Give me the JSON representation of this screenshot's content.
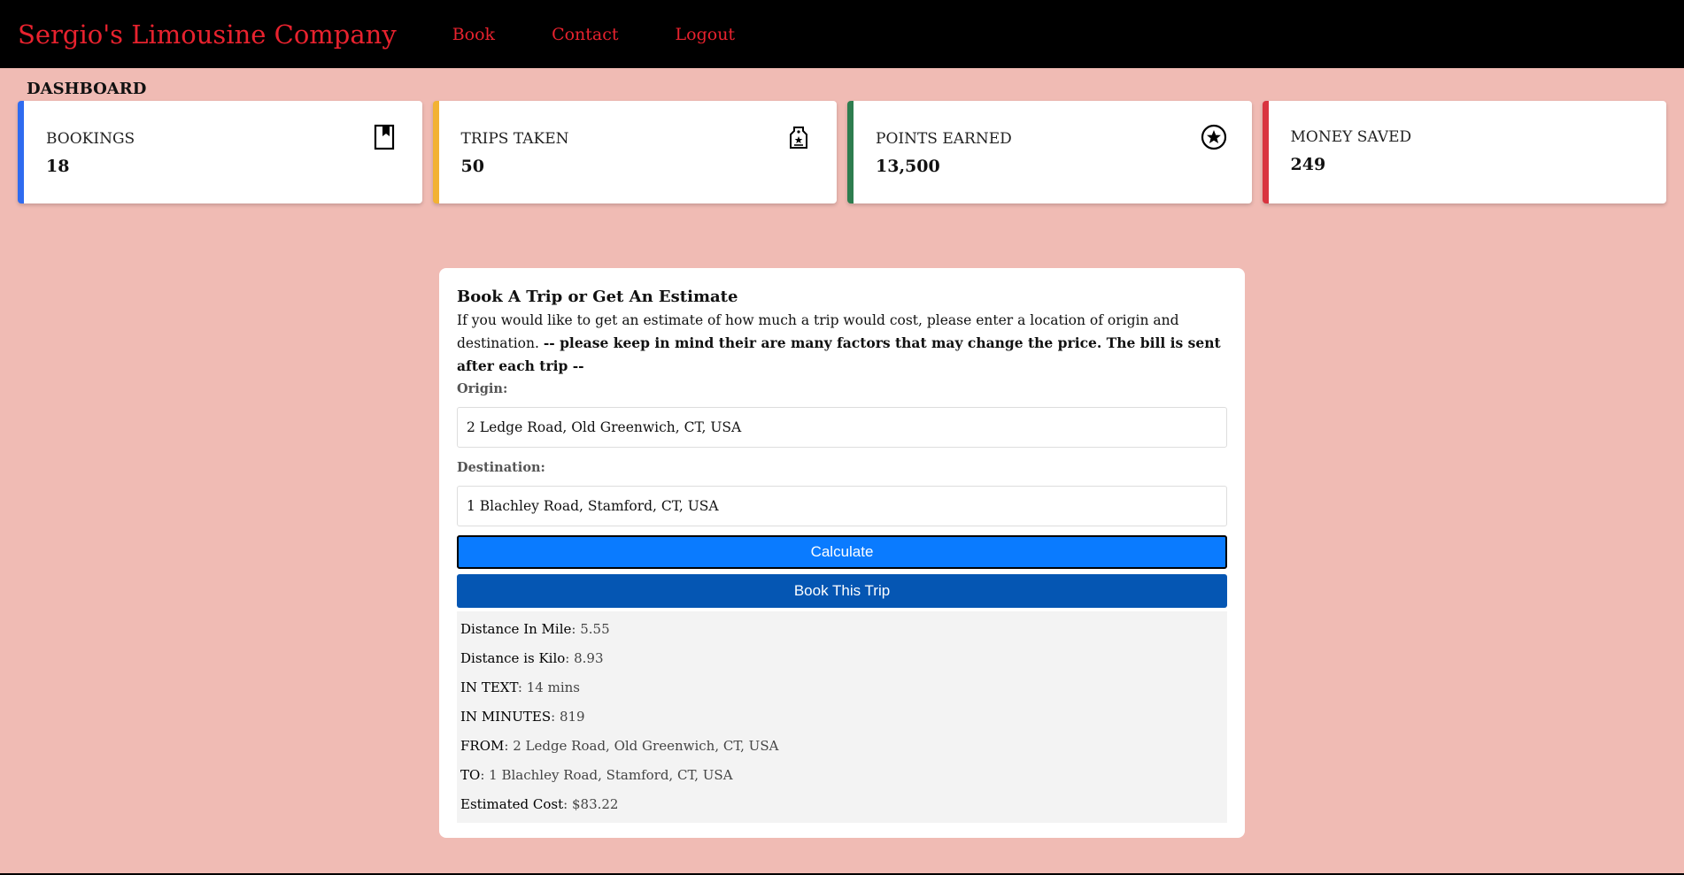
{
  "nav": {
    "brand": "Sergio's Limousine Company",
    "links": [
      "Book",
      "Contact",
      "Logout"
    ]
  },
  "dashboard": {
    "title": "DASHBOARD",
    "cards": [
      {
        "label": "BOOKINGS",
        "value": "18",
        "icon": "bookmark-icon",
        "accent": "#2f6bf0"
      },
      {
        "label": "TRIPS TAKEN",
        "value": "50",
        "icon": "luggage-tag-icon",
        "accent": "#f2b233"
      },
      {
        "label": "POINTS EARNED",
        "value": "13,500",
        "icon": "star-circle-icon",
        "accent": "#2e7d4f"
      },
      {
        "label": "MONEY SAVED",
        "value": "249",
        "icon": "",
        "accent": "#d9343f"
      }
    ]
  },
  "booking": {
    "title": "Book A Trip or Get An Estimate",
    "description": "If you would like to get an estimate of how much a trip would cost, please enter a location of origin and destination.",
    "note": "-- please keep in mind their are many factors that may change the price. The bill is sent after each trip --",
    "origin_label": "Origin:",
    "origin_value": "2 Ledge Road, Old Greenwich, CT, USA",
    "destination_label": "Destination:",
    "destination_value": "1 Blachley Road, Stamford, CT, USA",
    "calculate_label": "Calculate",
    "book_label": "Book This Trip"
  },
  "results": [
    {
      "key": "Distance In Mile",
      "value": "5.55"
    },
    {
      "key": "Distance is Kilo",
      "value": "8.93"
    },
    {
      "key": "IN TEXT",
      "value": "14 mins"
    },
    {
      "key": "IN MINUTES",
      "value": "819"
    },
    {
      "key": "FROM",
      "value": "2 Ledge Road, Old Greenwich, CT, USA"
    },
    {
      "key": "TO",
      "value": "1 Blachley Road, Stamford, CT, USA"
    },
    {
      "key": "Estimated Cost",
      "value": "$83.22"
    }
  ]
}
